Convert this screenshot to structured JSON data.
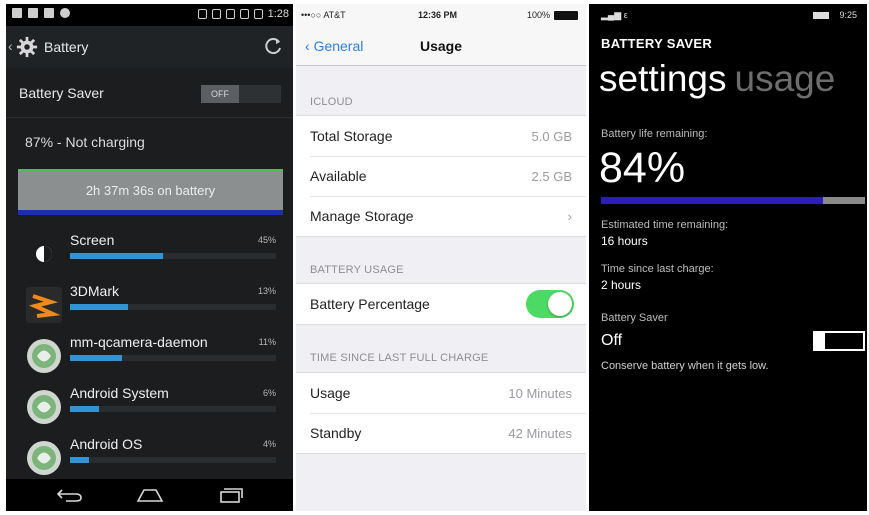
{
  "android": {
    "clock": "1:28",
    "title": "Battery",
    "battery_saver_label": "Battery Saver",
    "battery_saver_toggle": "OFF",
    "charge_status": "87% - Not charging",
    "graph_label": "2h 37m 36s on battery",
    "apps": [
      {
        "name": "Screen",
        "percent": "45%",
        "fraction": 0.45
      },
      {
        "name": "3DMark",
        "percent": "13%",
        "fraction": 0.28
      },
      {
        "name": "mm-qcamera-daemon",
        "percent": "11%",
        "fraction": 0.25
      },
      {
        "name": "Android System",
        "percent": "6%",
        "fraction": 0.14
      },
      {
        "name": "Android OS",
        "percent": "4%",
        "fraction": 0.09
      }
    ],
    "colors": {
      "bar": "#2f95d6",
      "graph_line": "#47c24b"
    }
  },
  "ios": {
    "carrier": "•••○○ AT&T",
    "time": "12:36 PM",
    "battery_text": "100%",
    "back_label": "General",
    "title": "Usage",
    "icloud_header": "ICLOUD",
    "icloud_rows": [
      {
        "label": "Total Storage",
        "value": "5.0 GB"
      },
      {
        "label": "Available",
        "value": "2.5 GB"
      },
      {
        "label": "Manage Storage",
        "value": "›"
      }
    ],
    "battery_header": "BATTERY USAGE",
    "battery_percentage_label": "Battery Percentage",
    "battery_percentage_on": true,
    "charge_header": "TIME SINCE LAST FULL CHARGE",
    "charge_rows": [
      {
        "label": "Usage",
        "value": "10 Minutes"
      },
      {
        "label": "Standby",
        "value": "42 Minutes"
      }
    ],
    "colors": {
      "tint": "#2b7fe6",
      "switch_on": "#4cd964"
    }
  },
  "wp": {
    "time": "9:25",
    "app_title": "BATTERY SAVER",
    "pivot_active": "settings",
    "pivot_inactive": "usage",
    "life_label": "Battery life remaining:",
    "life_value": "84%",
    "life_fraction": 0.84,
    "est_label": "Estimated time remaining:",
    "est_value": "16 hours",
    "since_label": "Time since last charge:",
    "since_value": "2 hours",
    "saver_label": "Battery Saver",
    "saver_state": "Off",
    "conserve_text": "Conserve battery when it gets low.",
    "colors": {
      "bar_fill": "#2b1fb4"
    }
  }
}
